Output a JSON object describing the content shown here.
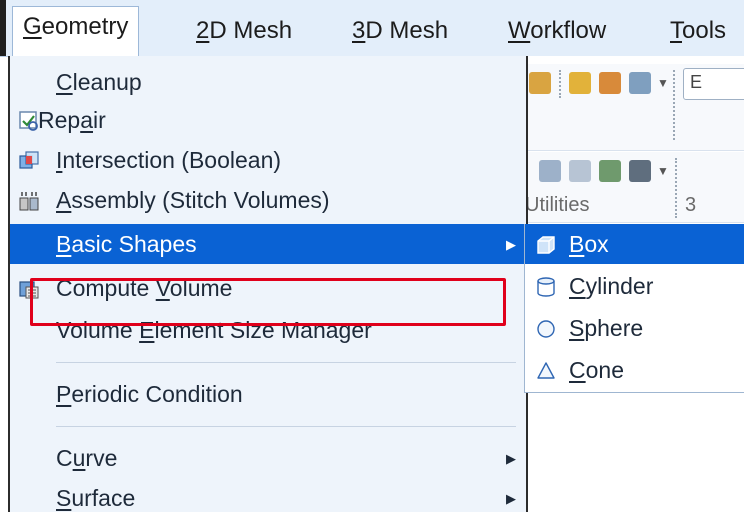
{
  "menubar": {
    "items": [
      {
        "pre": "",
        "u": "G",
        "post": "eometry"
      },
      {
        "pre": "",
        "u": "2",
        "post": "D Mesh"
      },
      {
        "pre": "",
        "u": "3",
        "post": "D Mesh"
      },
      {
        "pre": "",
        "u": "W",
        "post": "orkflow"
      },
      {
        "pre": "",
        "u": "T",
        "post": "ools"
      }
    ]
  },
  "ribbon": {
    "top_box_text": "E",
    "group_label": "Utilities",
    "edge_text": "3"
  },
  "menu": {
    "items": [
      {
        "pre": "",
        "u": "C",
        "post": "leanup",
        "icon": "none"
      },
      {
        "pre": "Rep",
        "u": "a",
        "post": "ir",
        "icon": "repair-icon"
      },
      {
        "pre": "",
        "u": "I",
        "post": "ntersection (Boolean)",
        "icon": "boolean-intersection-icon"
      },
      {
        "pre": "",
        "u": "A",
        "post": "ssembly (Stitch Volumes)",
        "icon": "assembly-icon"
      },
      {
        "pre": "",
        "u": "B",
        "post": "asic Shapes",
        "icon": "none"
      },
      {
        "pre": "Compute ",
        "u": "V",
        "post": "olume",
        "icon": "compute-volume-icon"
      },
      {
        "pre": "Volume ",
        "u": "E",
        "post": "lement Size Manager",
        "icon": "none"
      },
      {
        "pre": "",
        "u": "P",
        "post": "eriodic Condition",
        "icon": "none"
      },
      {
        "pre": "C",
        "u": "u",
        "post": "rve",
        "icon": "none"
      },
      {
        "pre": "",
        "u": "S",
        "post": "urface",
        "icon": "none"
      }
    ]
  },
  "submenu": {
    "items": [
      {
        "pre": "",
        "u": "B",
        "post": "ox",
        "icon": "box-icon"
      },
      {
        "pre": "",
        "u": "C",
        "post": "ylinder",
        "icon": "cylinder-icon"
      },
      {
        "pre": "",
        "u": "S",
        "post": "phere",
        "icon": "sphere-icon"
      },
      {
        "pre": "",
        "u": "C",
        "post": "one",
        "icon": "cone-icon"
      }
    ]
  },
  "colors": {
    "highlight": "#0a62d4",
    "annotation_red": "#e0001b",
    "menu_bg": "#eef4fb"
  }
}
